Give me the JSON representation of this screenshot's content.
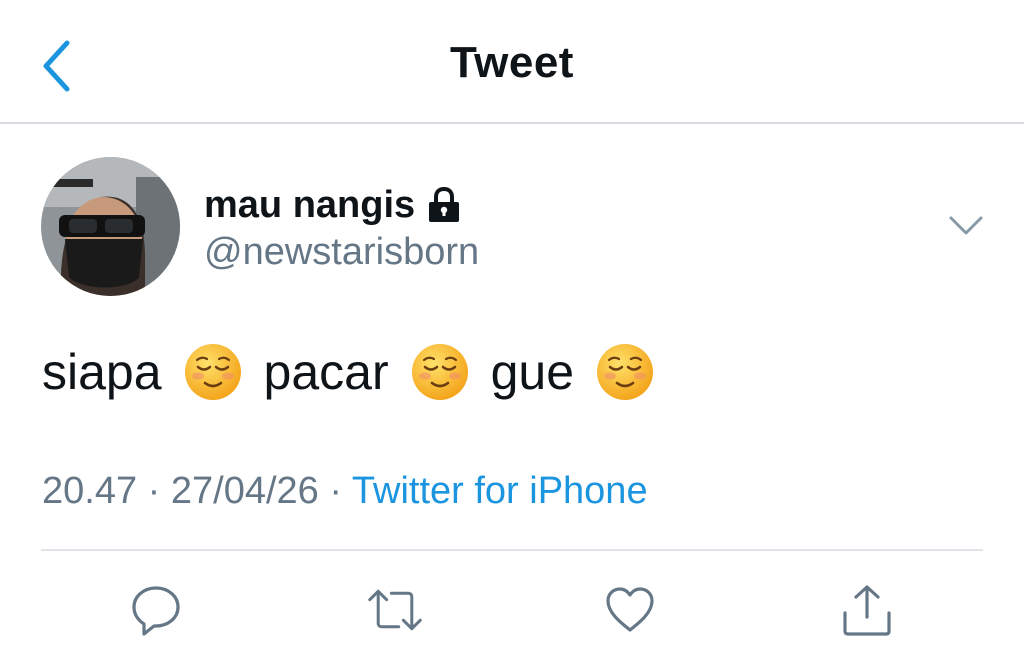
{
  "header": {
    "title": "Tweet",
    "back_icon": "chevron-left-icon"
  },
  "tweet": {
    "author": {
      "display_name": "mau nangis",
      "handle": "@newstarisborn",
      "protected_icon": "lock-icon"
    },
    "text_parts": [
      "siapa",
      "pacar",
      "gue"
    ],
    "emoji": "☺️",
    "meta": {
      "time": "20.47",
      "separator": "·",
      "date": "27/04/26",
      "source": "Twitter for iPhone"
    }
  },
  "actions": [
    "reply-icon",
    "retweet-icon",
    "like-icon",
    "share-icon"
  ],
  "colors": {
    "accent": "#1b95e0",
    "text": "#0f1419",
    "secondary": "#657786",
    "divider": "#e1e4e8"
  }
}
